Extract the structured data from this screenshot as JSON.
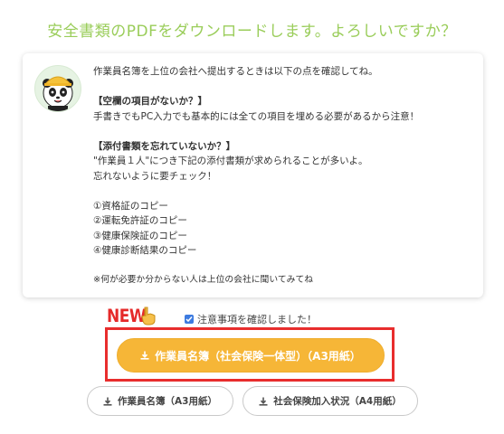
{
  "header": {
    "title": "安全書類のPDFをダウンロードします。よろしいですか？"
  },
  "notice": {
    "lines": [
      "作業員名簿を上位の会社へ提出するときは以下の点を確認してね。",
      "【空欄の項目がないか？】",
      "手書きでもPC入力でも基本的には全ての項目を埋める必要があるから注意！",
      "【添付書類を忘れていないか？】",
      "\"作業員１人\"につき下記の添付書類が求められることが多いよ。",
      "忘れないように要チェック！",
      "①資格証のコピー",
      "②運転免許証のコピー",
      "③健康保険証のコピー",
      "④健康診断結果のコピー",
      "※何が必要か分からない人は上位の会社に聞いてみてね"
    ]
  },
  "badge": {
    "new_label": "NEW"
  },
  "confirm": {
    "label": "注意事項を確認しました！",
    "checked": true
  },
  "buttons": {
    "main": "作業員名簿（社会保険一体型）（A3用紙）",
    "roster_a3": "作業員名簿（A3用紙）",
    "insurance_a4": "社会保険加入状況（A4用紙）"
  },
  "colors": {
    "title": "#9acd5a",
    "main_button": "#f6b637",
    "highlight_border": "#e82d2d",
    "checkbox": "#3d7be0"
  },
  "icons": {
    "download": "download-icon",
    "pointing_hand": "pointing-down-hand-icon",
    "mascot": "panda-worker-avatar"
  }
}
